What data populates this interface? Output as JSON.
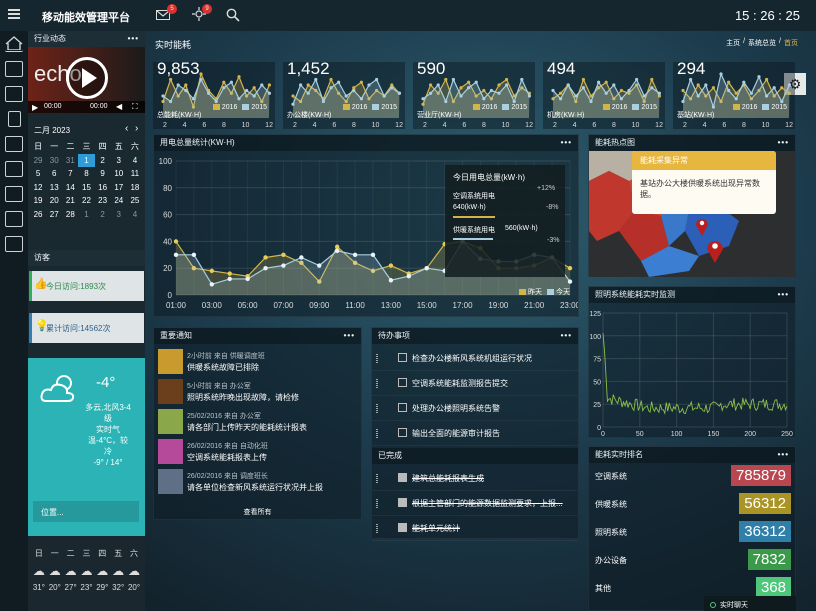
{
  "app": {
    "title": "移动能效管理平台",
    "clock": "15 : 26 : 25",
    "mail_badge": "5",
    "alert_badge": "9"
  },
  "breadcrumb": {
    "page_heading": "实时能耗",
    "home": "主页",
    "section": "系统总览",
    "current": "首页"
  },
  "sidebar_left": {
    "industry": {
      "title": "行业动态",
      "video_text": "echo",
      "time": "00:00",
      "time2": "00:00"
    },
    "calendar": {
      "month_label": "二月 2023",
      "weekdays": [
        "日",
        "一",
        "二",
        "三",
        "四",
        "五",
        "六"
      ],
      "weeks": [
        [
          "29",
          "30",
          "31",
          "1",
          "2",
          "3",
          "4"
        ],
        [
          "5",
          "6",
          "7",
          "8",
          "9",
          "10",
          "11"
        ],
        [
          "12",
          "13",
          "14",
          "15",
          "16",
          "17",
          "18"
        ],
        [
          "19",
          "20",
          "21",
          "22",
          "23",
          "24",
          "25"
        ],
        [
          "26",
          "27",
          "28",
          "1",
          "2",
          "3",
          "4"
        ]
      ]
    },
    "visitors": {
      "title": "访客",
      "today": "今日访问:1893次",
      "total": "累计访问:14562次"
    },
    "weather": {
      "temp": "-4°",
      "desc_lines": [
        "多云,北风3-4",
        "级",
        "实时气",
        "温-4°C，较",
        "冷",
        "-9° / 14°"
      ],
      "location_placeholder": "位置...",
      "week_days": [
        "日",
        "一",
        "二",
        "三",
        "四",
        "五",
        "六"
      ],
      "week_temps": [
        "31°",
        "20°",
        "27°",
        "23°",
        "29°",
        "32°",
        "20°"
      ]
    }
  },
  "tiles": [
    {
      "value": "9,853",
      "label": "总能耗(KW·H)"
    },
    {
      "value": "1,452",
      "label": "办公楼(KW·H)"
    },
    {
      "value": "590",
      "label": "营业厅(KW·H)"
    },
    {
      "value": "494",
      "label": "机房(KW·H)"
    },
    {
      "value": "294",
      "label": "基站(KW·H)"
    }
  ],
  "tile_axis": [
    "2",
    "4",
    "6",
    "8",
    "10",
    "12"
  ],
  "tile_legend": [
    "2016",
    "2015"
  ],
  "usage_chart": {
    "title": "用电总量统计(KW·H)",
    "popup": {
      "title": "今日用电总量(kW·h)",
      "change_total": "+12%",
      "row1_name": "空调系统用电",
      "row1_value": "640(kW·h)",
      "row1_change": "-8%",
      "row2_name": "供暖系统用电",
      "row2_value": "560(kW·h)",
      "row2_change": "-3%"
    },
    "legend": [
      "昨天",
      "今天"
    ]
  },
  "chart_data": {
    "type": "line",
    "x": [
      "01:00",
      "02:00",
      "03:00",
      "04:00",
      "05:00",
      "06:00",
      "07:00",
      "08:00",
      "09:00",
      "10:00",
      "11:00",
      "12:00",
      "13:00",
      "14:00",
      "15:00",
      "16:00",
      "17:00",
      "18:00",
      "19:00",
      "20:00",
      "21:00",
      "22:00",
      "23:00"
    ],
    "xticks": [
      "01:00",
      "03:00",
      "05:00",
      "07:00",
      "09:00",
      "11:00",
      "13:00",
      "15:00",
      "17:00",
      "19:00",
      "21:00",
      "23:00"
    ],
    "yticks": [
      "0",
      "20",
      "40",
      "60",
      "80",
      "100"
    ],
    "ylim": [
      0,
      100
    ],
    "series": [
      {
        "name": "昨天",
        "color": "#d2b44a",
        "values": [
          40,
          20,
          18,
          16,
          14,
          28,
          30,
          24,
          10,
          36,
          24,
          18,
          22,
          16,
          20,
          38,
          40,
          35,
          20,
          20,
          22,
          28,
          20
        ]
      },
      {
        "name": "今天",
        "color": "#a9cfe0",
        "values": [
          30,
          30,
          8,
          12,
          12,
          20,
          22,
          28,
          22,
          33,
          30,
          30,
          11,
          14,
          20,
          18,
          40,
          27,
          25,
          25,
          30,
          28,
          10
        ]
      }
    ]
  },
  "heatmap": {
    "title": "能耗热点图",
    "tooltip_title": "能耗采集异常",
    "tooltip_body": "基站办公大楼供暖系统出现异常数据。"
  },
  "lighting": {
    "title": "照明系统能耗实时监测",
    "yticks": [
      "0",
      "25",
      "50",
      "75",
      "100",
      "125"
    ],
    "xticks": [
      "0",
      "50",
      "100",
      "150",
      "200",
      "250"
    ]
  },
  "notices": {
    "title": "重要通知",
    "more": "查看所有",
    "items": [
      {
        "meta": "2小时前 来自 供暖调度班",
        "text": "供暖系统故障已排除",
        "color": "#c99a2e"
      },
      {
        "meta": "5小时前 来自 办公室",
        "text": "照明系统昨晚出现故障，请检修",
        "color": "#6b3e1c"
      },
      {
        "meta": "25/02/2016 来自 办公室",
        "text": "请各部门上传昨天的能耗统计报表",
        "color": "#8aa84a"
      },
      {
        "meta": "26/02/2016 来自 自动化班",
        "text": "空调系统能耗报表上传",
        "color": "#b54a9a"
      },
      {
        "meta": "26/02/2016 来自 调度班长",
        "text": "请各单位检查新风系统运行状况并上报",
        "color": "#5e6f86"
      }
    ]
  },
  "todos": {
    "title": "待办事项",
    "pending": [
      "检查办公楼新风系统机组运行状况",
      "空调系统能耗监测报告提交",
      "处理办公楼照明系统告警",
      "输出全面的能源审计报告"
    ],
    "done_title": "已完成",
    "done": [
      "建筑总能耗报表生成",
      "根据主管部门的能源数据监测要求，上报...",
      "能耗单元统计"
    ]
  },
  "ranking": {
    "title": "能耗实时排名",
    "items": [
      {
        "name": "空调系统",
        "value": "785879",
        "color": "#b8474f"
      },
      {
        "name": "供暖系统",
        "value": "56312",
        "color": "#a99425"
      },
      {
        "name": "照明系统",
        "value": "36312",
        "color": "#2f7fa8"
      },
      {
        "name": "办公设备",
        "value": "7832",
        "color": "#3a9a4a"
      },
      {
        "name": "其他",
        "value": "368",
        "color": "#4ec77a"
      }
    ]
  },
  "chat": {
    "label": "实时聊天"
  },
  "icons": [
    "menu-icon",
    "mail-icon",
    "alert-icon",
    "search-icon",
    "settings-icon"
  ]
}
